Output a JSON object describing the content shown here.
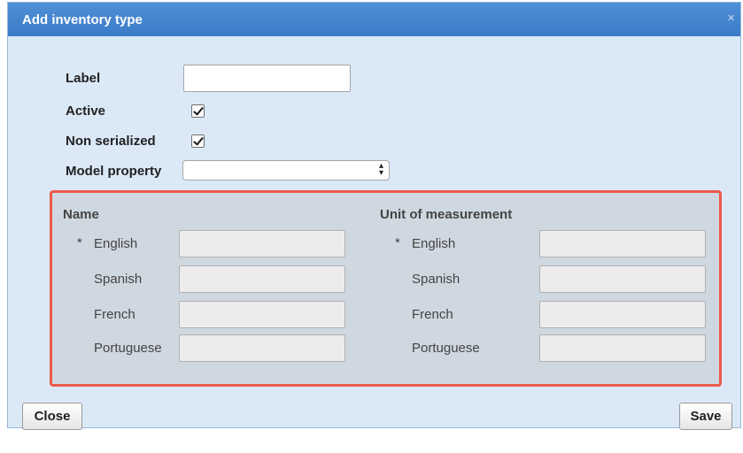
{
  "dialog": {
    "title": "Add inventory type",
    "close_icon": "×"
  },
  "form": {
    "label_label": "Label",
    "label_value": "",
    "active_label": "Active",
    "active_checked": true,
    "non_serialized_label": "Non serialized",
    "non_serialized_checked": true,
    "model_property_label": "Model property",
    "model_property_value": ""
  },
  "translations": {
    "name_heading": "Name",
    "unit_heading": "Unit of measurement",
    "required_marker": "*",
    "languages": [
      "English",
      "Spanish",
      "French",
      "Portuguese"
    ]
  },
  "footer": {
    "close_label": "Close",
    "save_label": "Save"
  },
  "colors": {
    "titlebar": "#3a7cc8",
    "dialog_bg": "#dbe9f7",
    "panel_bg": "#cfd7e0",
    "highlight_border": "#ec5a4a"
  }
}
